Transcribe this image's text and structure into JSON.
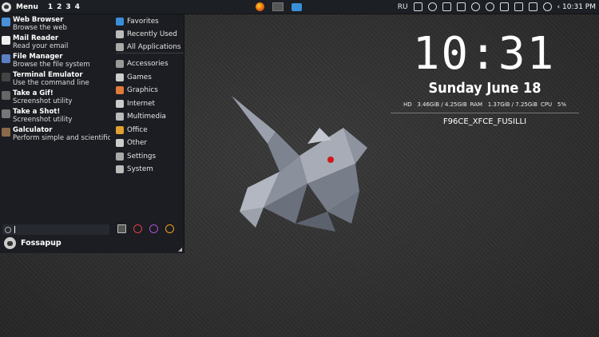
{
  "panel": {
    "menu_label": "Menu",
    "workspaces": [
      "1",
      "2",
      "3",
      "4"
    ],
    "launchers": [
      "firefox-icon",
      "terminal-icon",
      "file-manager-icon"
    ],
    "keyboard_layout": "RU",
    "clock": "‹ 10:31 PM"
  },
  "favorites": [
    {
      "title": "Web Browser",
      "subtitle": "Browse the web",
      "icon": "globe-icon",
      "color": "#4a90d9"
    },
    {
      "title": "Mail Reader",
      "subtitle": "Read your email",
      "icon": "mail-icon",
      "color": "#eeeeee"
    },
    {
      "title": "File Manager",
      "subtitle": "Browse the file system",
      "icon": "folder-icon",
      "color": "#5b7fc7"
    },
    {
      "title": "Terminal Emulator",
      "subtitle": "Use the command line",
      "icon": "terminal-icon",
      "color": "#444444"
    },
    {
      "title": "Take a Gif!",
      "subtitle": "Screenshot utility",
      "icon": "camera-icon",
      "color": "#666666"
    },
    {
      "title": "Take a Shot!",
      "subtitle": "Screenshot utility",
      "icon": "camera-icon",
      "color": "#777777"
    },
    {
      "title": "Galculator",
      "subtitle": "Perform simple and scientific calculations",
      "icon": "calculator-icon",
      "color": "#8a6a4a"
    }
  ],
  "categories": [
    {
      "label": "Favorites",
      "icon": "favorites-icon",
      "color": "#3a8fd8"
    },
    {
      "label": "Recently Used",
      "icon": "recent-icon",
      "color": "#bbbbbb"
    },
    {
      "label": "All Applications",
      "icon": "all-apps-icon",
      "color": "#aaaaaa"
    },
    {
      "label": "Accessories",
      "icon": "accessories-icon",
      "color": "#999999"
    },
    {
      "label": "Games",
      "icon": "games-icon",
      "color": "#cccccc"
    },
    {
      "label": "Graphics",
      "icon": "graphics-icon",
      "color": "#e07a3a"
    },
    {
      "label": "Internet",
      "icon": "internet-icon",
      "color": "#cccccc"
    },
    {
      "label": "Multimedia",
      "icon": "multimedia-icon",
      "color": "#bbbbbb"
    },
    {
      "label": "Office",
      "icon": "office-icon",
      "color": "#e0a030"
    },
    {
      "label": "Other",
      "icon": "other-icon",
      "color": "#cccccc"
    },
    {
      "label": "Settings",
      "icon": "settings-icon",
      "color": "#aaaaaa"
    },
    {
      "label": "System",
      "icon": "system-icon",
      "color": "#bbbbbb"
    }
  ],
  "search": {
    "value": ""
  },
  "actions": [
    {
      "name": "settings-manager-icon",
      "color": "#bbbbbb"
    },
    {
      "name": "lock-screen-icon",
      "color": "#e04040"
    },
    {
      "name": "switch-user-icon",
      "color": "#b050d0"
    },
    {
      "name": "logout-icon",
      "color": "#f0a020"
    }
  ],
  "user": {
    "name": "Fossapup"
  },
  "conky": {
    "time": "10:31",
    "date": "Sunday June 18",
    "hd_label": "HD",
    "hd_value": "3.46GiB / 4.25GiB",
    "ram_label": "RAM",
    "ram_value": "1.37GiB / 7.25GiB",
    "cpu_label": "CPU",
    "cpu_value": "5%",
    "hostname": "F96CE_XFCE_FUSILLI"
  }
}
